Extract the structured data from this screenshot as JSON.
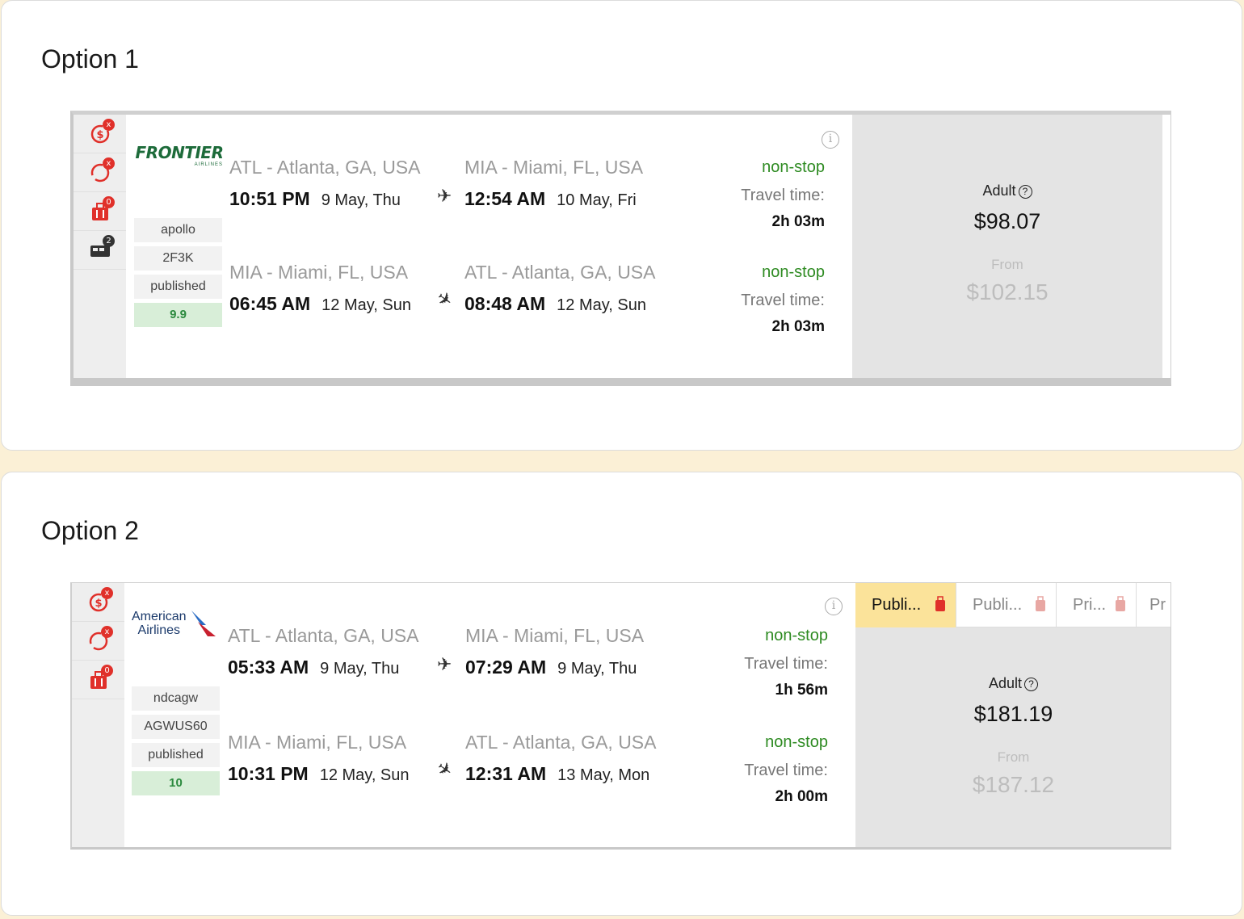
{
  "options": [
    {
      "title": "Option 1",
      "airline": "Frontier Airlines",
      "logo_text": "FRONTIER",
      "logo_sub": "AIRLINES",
      "tags": [
        "apollo",
        "2F3K",
        "published"
      ],
      "score": "9.9",
      "badges": [
        "x",
        "x",
        "0",
        "2"
      ],
      "outbound": {
        "from_city": "ATL - Atlanta, GA, USA",
        "dep_time": "10:51 PM",
        "dep_date": "9 May, Thu",
        "to_city": "MIA - Miami, FL, USA",
        "arr_time": "12:54 AM",
        "arr_date": "10 May, Fri",
        "stops": "non-stop",
        "travel_label": "Travel time:",
        "travel_time": "2h 03m"
      },
      "inbound": {
        "from_city": "MIA - Miami, FL, USA",
        "dep_time": "06:45 AM",
        "dep_date": "12 May, Sun",
        "to_city": "ATL - Atlanta, GA, USA",
        "arr_time": "08:48 AM",
        "arr_date": "12 May, Sun",
        "stops": "non-stop",
        "travel_label": "Travel time:",
        "travel_time": "2h 03m"
      },
      "price": {
        "passenger": "Adult",
        "amount": "$98.07",
        "from_label": "From",
        "from_amount": "$102.15"
      }
    },
    {
      "title": "Option 2",
      "airline": "American Airlines",
      "logo_text": "American",
      "logo_sub": "Airlines",
      "tags": [
        "ndcagw",
        "AGWUS60",
        "published"
      ],
      "score": "10",
      "badges": [
        "x",
        "x",
        "0"
      ],
      "fare_tabs": [
        "Publi...",
        "Publi...",
        "Pri...",
        "Pr"
      ],
      "outbound": {
        "from_city": "ATL - Atlanta, GA, USA",
        "dep_time": "05:33 AM",
        "dep_date": "9 May, Thu",
        "to_city": "MIA - Miami, FL, USA",
        "arr_time": "07:29 AM",
        "arr_date": "9 May, Thu",
        "stops": "non-stop",
        "travel_label": "Travel time:",
        "travel_time": "1h 56m"
      },
      "inbound": {
        "from_city": "MIA - Miami, FL, USA",
        "dep_time": "10:31 PM",
        "dep_date": "12 May, Sun",
        "to_city": "ATL - Atlanta, GA, USA",
        "arr_time": "12:31 AM",
        "arr_date": "13 May, Mon",
        "stops": "non-stop",
        "travel_label": "Travel time:",
        "travel_time": "2h 00m"
      },
      "price": {
        "passenger": "Adult",
        "amount": "$181.19",
        "from_label": "From",
        "from_amount": "$187.12"
      }
    }
  ],
  "colors": {
    "accent_red": "#e0302a",
    "nonstop_green": "#2e8b22",
    "score_bg": "#d8eed8",
    "active_tab": "#fbe39a",
    "page_bg": "#fbf0d6"
  },
  "icons": [
    "no-refund-icon",
    "no-change-icon",
    "baggage-icon",
    "seat-icon",
    "info-icon",
    "plane-departure-icon",
    "plane-arrival-icon",
    "help-icon"
  ]
}
